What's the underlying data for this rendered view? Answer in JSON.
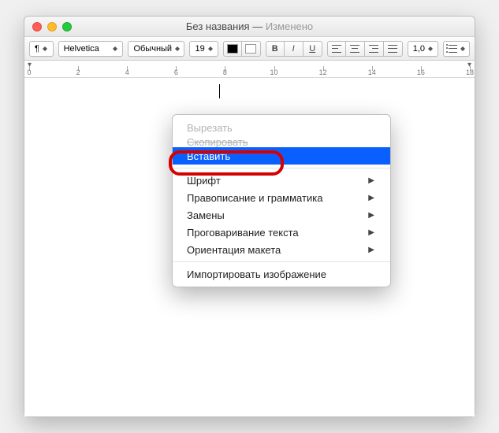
{
  "title": {
    "main": "Без названия",
    "sep": " — ",
    "modified": "Изменено"
  },
  "toolbar": {
    "style_menu": "¶",
    "font": "Helvetica",
    "weight": "Обычный",
    "size": "19",
    "bold": "B",
    "italic": "I",
    "underline": "U",
    "line_spacing": "1,0"
  },
  "ruler": {
    "ticks": [
      0,
      2,
      4,
      6,
      8,
      10,
      12,
      14,
      16,
      18
    ]
  },
  "context_menu": {
    "cut": "Вырезать",
    "copy": "Скопировать",
    "paste": "Вставить",
    "font": "Шрифт",
    "spelling": "Правописание и грамматика",
    "substitutions": "Замены",
    "speech": "Проговаривание текста",
    "layout": "Ориентация макета",
    "import_image": "Импортировать изображение"
  }
}
